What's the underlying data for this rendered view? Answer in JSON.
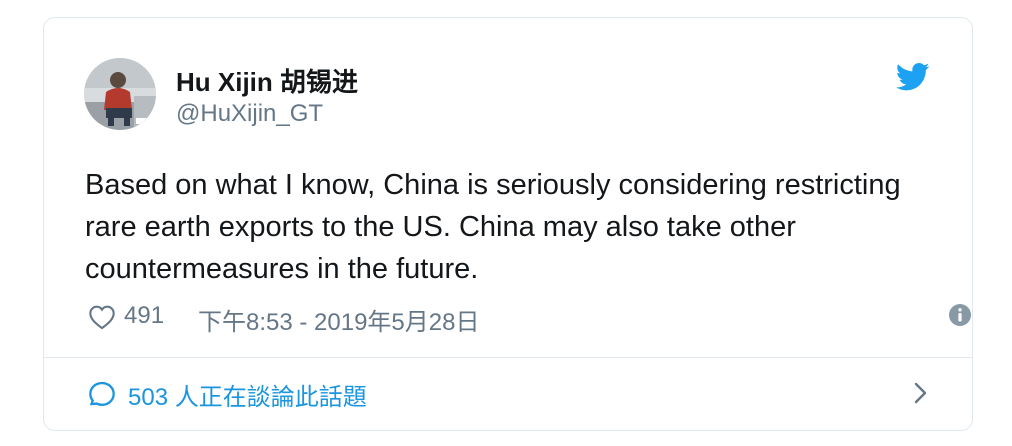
{
  "tweet": {
    "author_name": "Hu Xijin 胡锡进",
    "handle": "@HuXijin_GT",
    "text": "Based on what I know, China is seriously considering restricting rare earth exports to the US. China may also take other countermeasures in the future.",
    "likes": "491",
    "datetime": "下午8:53 - 2019年5月28日",
    "conversation": "503 人正在談論此話題"
  },
  "icons": {
    "logo": "twitter-bird-icon",
    "like": "heart-icon",
    "info": "info-icon",
    "reply": "speech-bubble-icon",
    "navigate": "chevron-right-icon"
  },
  "colors": {
    "brand": "#1da1f2",
    "link": "#1b95e0",
    "muted": "#657786",
    "text": "#14171a",
    "border": "#e1e8ed"
  }
}
